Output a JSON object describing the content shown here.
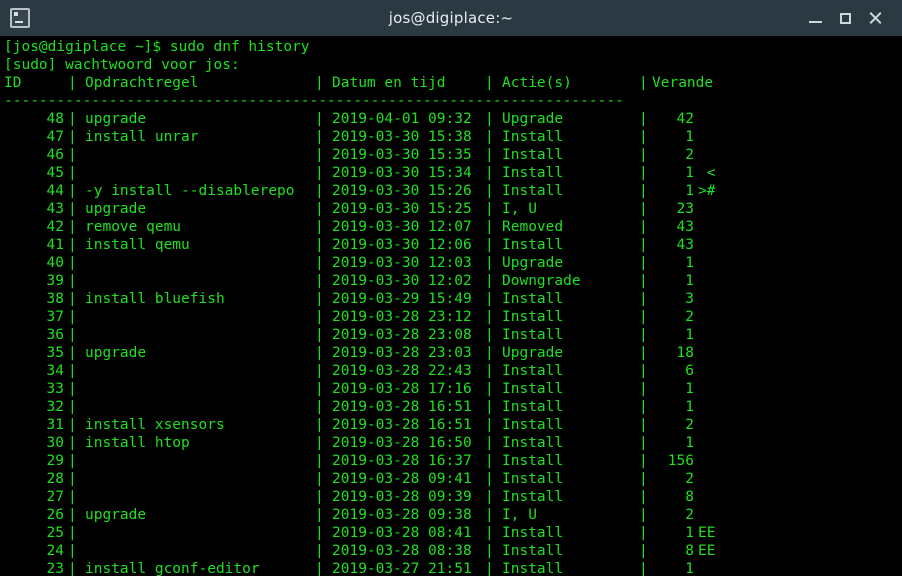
{
  "window": {
    "title": "jos@digiplace:~",
    "icon": "terminal-icon",
    "controls": {
      "minimize": "minimize",
      "maximize": "maximize",
      "close": "close"
    },
    "titlebar_color": "#2b3a42",
    "background_color": "#000000",
    "text_color": "#1fe01f"
  },
  "terminal": {
    "prompt_line": "[jos@digiplace ~]$ sudo dnf history",
    "sudo_line": "[sudo] wachtwoord voor jos:",
    "separator": "-----------------------------------------------------------------------",
    "pipe": "|",
    "headers": {
      "id": "ID",
      "command": "Opdrachtregel",
      "datetime": "Datum en tijd",
      "action": "Actie(s)",
      "changed": "Verande"
    },
    "rows": [
      {
        "id": "48",
        "command": "upgrade",
        "datetime": "2019-04-01 09:32",
        "action": "Upgrade",
        "changed": "42",
        "flag": ""
      },
      {
        "id": "47",
        "command": "install unrar",
        "datetime": "2019-03-30 15:38",
        "action": "Install",
        "changed": "1",
        "flag": ""
      },
      {
        "id": "46",
        "command": "",
        "datetime": "2019-03-30 15:35",
        "action": "Install",
        "changed": "2",
        "flag": ""
      },
      {
        "id": "45",
        "command": "",
        "datetime": "2019-03-30 15:34",
        "action": "Install",
        "changed": "1",
        "flag": " <"
      },
      {
        "id": "44",
        "command": "-y install --disablerepo",
        "datetime": "2019-03-30 15:26",
        "action": "Install",
        "changed": "1",
        "flag": ">#"
      },
      {
        "id": "43",
        "command": "upgrade",
        "datetime": "2019-03-30 15:25",
        "action": "I, U",
        "changed": "23",
        "flag": ""
      },
      {
        "id": "42",
        "command": "remove qemu",
        "datetime": "2019-03-30 12:07",
        "action": "Removed",
        "changed": "43",
        "flag": ""
      },
      {
        "id": "41",
        "command": "install qemu",
        "datetime": "2019-03-30 12:06",
        "action": "Install",
        "changed": "43",
        "flag": ""
      },
      {
        "id": "40",
        "command": "",
        "datetime": "2019-03-30 12:03",
        "action": "Upgrade",
        "changed": "1",
        "flag": ""
      },
      {
        "id": "39",
        "command": "",
        "datetime": "2019-03-30 12:02",
        "action": "Downgrade",
        "changed": "1",
        "flag": ""
      },
      {
        "id": "38",
        "command": "install bluefish",
        "datetime": "2019-03-29 15:49",
        "action": "Install",
        "changed": "3",
        "flag": ""
      },
      {
        "id": "37",
        "command": "",
        "datetime": "2019-03-28 23:12",
        "action": "Install",
        "changed": "2",
        "flag": ""
      },
      {
        "id": "36",
        "command": "",
        "datetime": "2019-03-28 23:08",
        "action": "Install",
        "changed": "1",
        "flag": ""
      },
      {
        "id": "35",
        "command": "upgrade",
        "datetime": "2019-03-28 23:03",
        "action": "Upgrade",
        "changed": "18",
        "flag": ""
      },
      {
        "id": "34",
        "command": "",
        "datetime": "2019-03-28 22:43",
        "action": "Install",
        "changed": "6",
        "flag": ""
      },
      {
        "id": "33",
        "command": "",
        "datetime": "2019-03-28 17:16",
        "action": "Install",
        "changed": "1",
        "flag": ""
      },
      {
        "id": "32",
        "command": "",
        "datetime": "2019-03-28 16:51",
        "action": "Install",
        "changed": "1",
        "flag": ""
      },
      {
        "id": "31",
        "command": "install xsensors",
        "datetime": "2019-03-28 16:51",
        "action": "Install",
        "changed": "2",
        "flag": ""
      },
      {
        "id": "30",
        "command": "install htop",
        "datetime": "2019-03-28 16:50",
        "action": "Install",
        "changed": "1",
        "flag": ""
      },
      {
        "id": "29",
        "command": "",
        "datetime": "2019-03-28 16:37",
        "action": "Install",
        "changed": "156",
        "flag": ""
      },
      {
        "id": "28",
        "command": "",
        "datetime": "2019-03-28 09:41",
        "action": "Install",
        "changed": "2",
        "flag": ""
      },
      {
        "id": "27",
        "command": "",
        "datetime": "2019-03-28 09:39",
        "action": "Install",
        "changed": "8",
        "flag": ""
      },
      {
        "id": "26",
        "command": "upgrade",
        "datetime": "2019-03-28 09:38",
        "action": "I, U",
        "changed": "2",
        "flag": ""
      },
      {
        "id": "25",
        "command": "",
        "datetime": "2019-03-28 08:41",
        "action": "Install",
        "changed": "1",
        "flag": "EE"
      },
      {
        "id": "24",
        "command": "",
        "datetime": "2019-03-28 08:38",
        "action": "Install",
        "changed": "8",
        "flag": "EE"
      },
      {
        "id": "23",
        "command": "install gconf-editor",
        "datetime": "2019-03-27 21:51",
        "action": "Install",
        "changed": "1",
        "flag": ""
      }
    ]
  }
}
